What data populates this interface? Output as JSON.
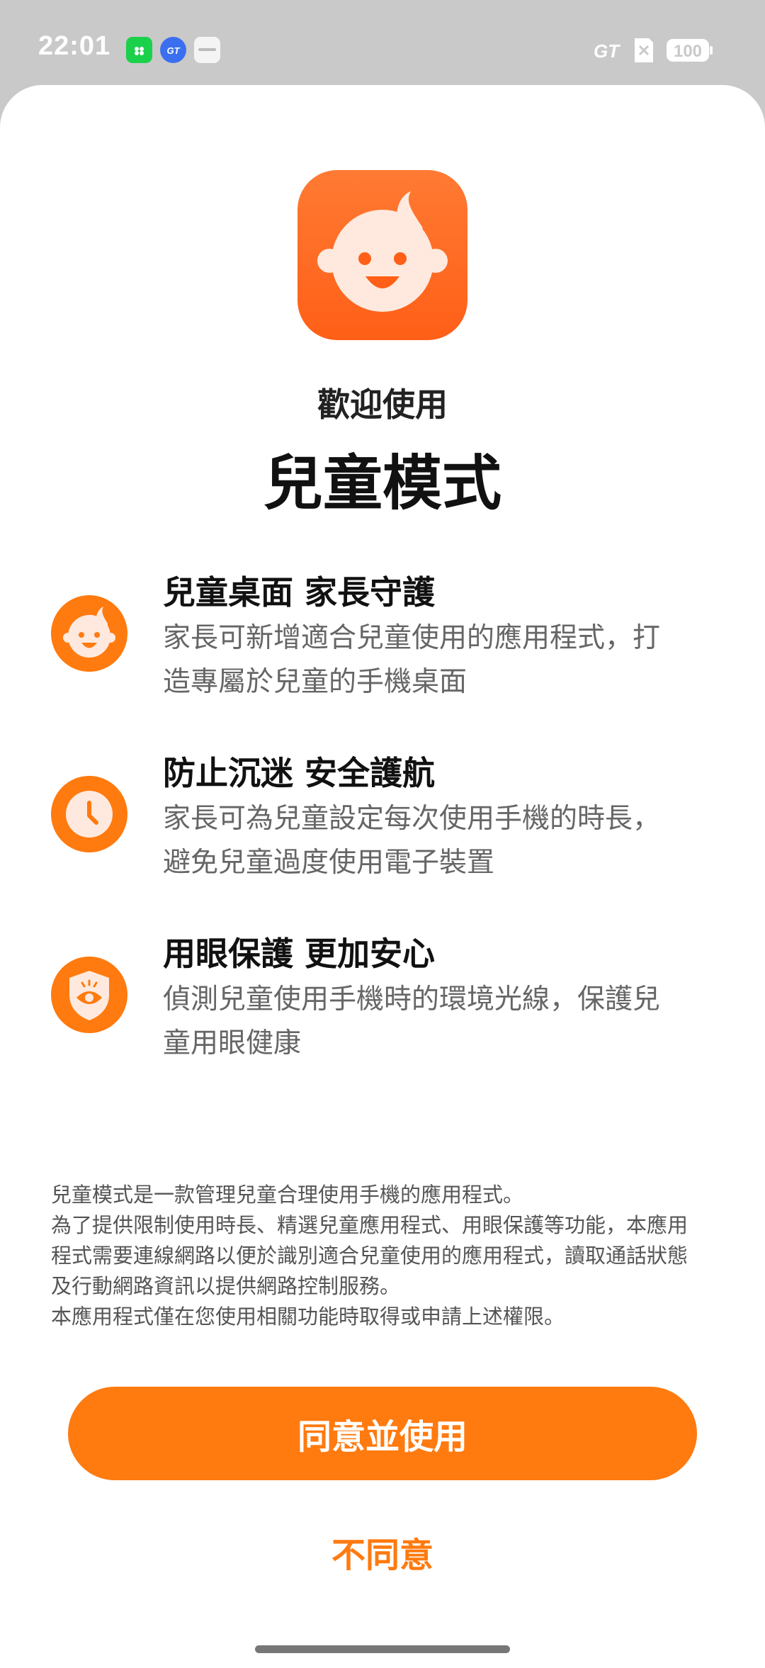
{
  "status_bar": {
    "time": "22:01",
    "battery": "100",
    "network_label": "GT",
    "app_icons": [
      "wechat-icon",
      "gt-mode-icon",
      "realme-icon"
    ]
  },
  "header": {
    "welcome": "歡迎使用",
    "title": "兒童模式"
  },
  "features": [
    {
      "title": "兒童桌面 家長守護",
      "desc_line1": "家長可新增適合兒童使用的應用程式，打",
      "desc_line2": "造專屬於兒童的手機桌面",
      "icon": "child-face-icon"
    },
    {
      "title": "防止沉迷 安全護航",
      "desc_line1": "家長可為兒童設定每次使用手機的時長，",
      "desc_line2": "避免兒童過度使用電子裝置",
      "icon": "clock-icon"
    },
    {
      "title": "用眼保護 更加安心",
      "desc_line1": "偵測兒童使用手機時的環境光線，保護兒",
      "desc_line2": "童用眼健康",
      "icon": "eye-shield-icon"
    }
  ],
  "notice": {
    "line1": "兒童模式是一款管理兒童合理使用手機的應用程式。",
    "line2": "為了提供限制使用時長、精選兒童應用程式、用眼保護等功能，本應用",
    "line3": "程式需要連線網路以便於識別適合兒童使用的應用程式，讀取通話狀態",
    "line4": "及行動網路資訊以提供網路控制服務。",
    "line5": "本應用程式僅在您使用相關功能時取得或申請上述權限。"
  },
  "actions": {
    "agree_label": "同意並使用",
    "disagree_label": "不同意"
  },
  "colors": {
    "accent": "#ff7a0f",
    "icon_gradient_top": "#ff7a33",
    "icon_gradient_bottom": "#ff5f17"
  }
}
